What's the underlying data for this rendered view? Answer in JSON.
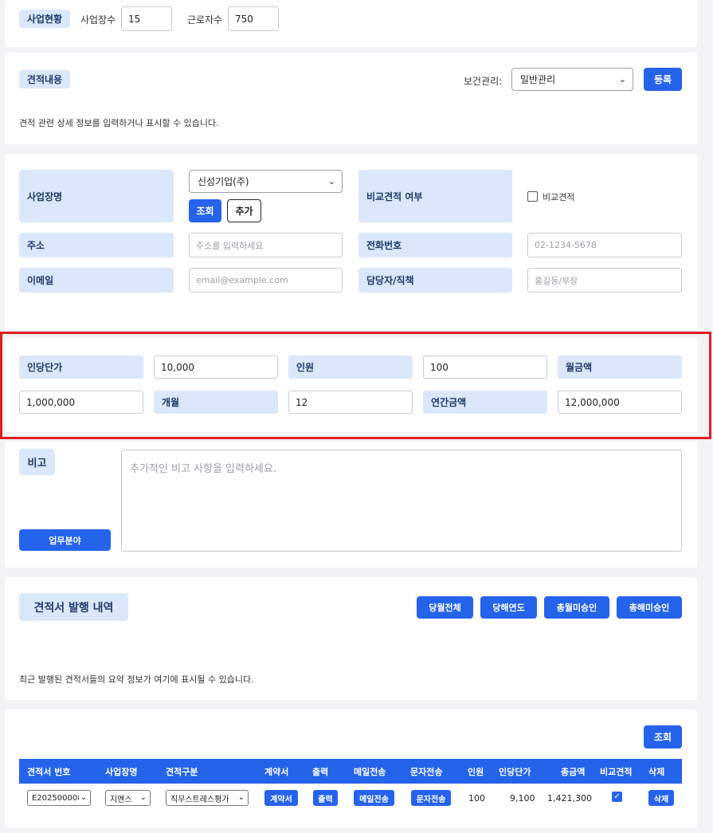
{
  "status": {
    "tag": "사업현황",
    "sites_label": "사업장수",
    "sites_value": "15",
    "workers_label": "근로자수",
    "workers_value": "750"
  },
  "quote": {
    "tag": "견적내용",
    "health_label": "보건관리:",
    "health_value": "일반관리",
    "register_label": "등록",
    "description": "견적 관련 상세 정보를 입력하거나 표시할 수 있습니다."
  },
  "site": {
    "name_label": "사업장명",
    "company_value": "신성기업(주)",
    "lookup_label": "조회",
    "add_label": "추가",
    "compare_label": "비교견적 여부",
    "compare_checkbox_label": "비교견적",
    "address_label": "주소",
    "address_placeholder": "주소를 입력하세요",
    "phone_label": "전화번호",
    "phone_placeholder": "02-1234-5678",
    "email_label": "이메일",
    "email_placeholder": "email@example.com",
    "contact_label": "담당자/직책",
    "contact_placeholder": "홍길동/부장"
  },
  "pricing": {
    "unit_price_label": "인당단가",
    "unit_price_value": "10,000",
    "headcount_label": "인원",
    "headcount_value": "100",
    "monthly_label": "월금액",
    "monthly_value": "1,000,000",
    "months_label": "개월",
    "months_value": "12",
    "annual_label": "연간금액",
    "annual_value": "12,000,000"
  },
  "notes": {
    "label": "비고",
    "placeholder": "추가적인 비고 사항을 입력하세요.",
    "business_button": "업무분야"
  },
  "history": {
    "title": "견적서 발행 내역",
    "buttons": [
      "당월전체",
      "당해연도",
      "총월미승인",
      "총해미승인"
    ],
    "description": "최근 발행된 견적서들의 요약 정보가 여기에 표시될 수 있습니다."
  },
  "table": {
    "lookup_label": "조회",
    "headers": [
      "견적서 번호",
      "사업장명",
      "견적구분",
      "계약서",
      "출력",
      "메일전송",
      "문자전송",
      "인원",
      "인당단가",
      "총금액",
      "비교견적",
      "삭제"
    ],
    "rows": [
      {
        "quote_no": "E202500008",
        "site": "지멘스",
        "type": "직무스트레스평가",
        "contract": "계약서",
        "print": "출력",
        "mail": "메일전송",
        "sms": "문자전송",
        "headcount": "100",
        "unit_price": "9,100",
        "total": "1,421,300",
        "compare_checked": true,
        "delete": "삭제"
      }
    ]
  },
  "colors": {
    "accent": "#2563eb",
    "label_bg": "#dbe7fb",
    "highlight": "#e11d24"
  }
}
